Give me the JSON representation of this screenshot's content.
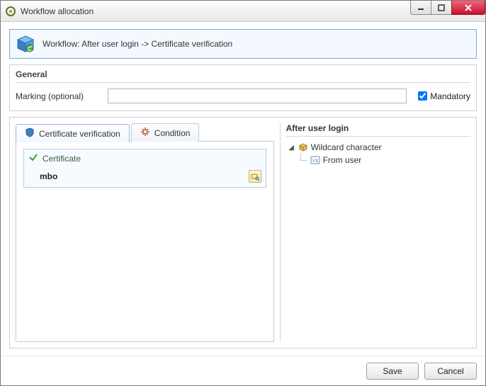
{
  "window": {
    "title": "Workflow allocation"
  },
  "info": {
    "text": "Workflow: After user login -> Certificate verification"
  },
  "general": {
    "title": "General",
    "marking_label": "Marking (optional)",
    "marking_value": "",
    "mandatory_label": "Mandatory",
    "mandatory_checked": true
  },
  "tabs": {
    "cert_label": "Certificate verification",
    "cond_label": "Condition",
    "active": "cert"
  },
  "certificate": {
    "group_label": "Certificate",
    "value": "mbo"
  },
  "right": {
    "title": "After user login",
    "tree": {
      "root_label": "Wildcard character",
      "child_label": "From user"
    }
  },
  "footer": {
    "save_label": "Save",
    "cancel_label": "Cancel"
  }
}
